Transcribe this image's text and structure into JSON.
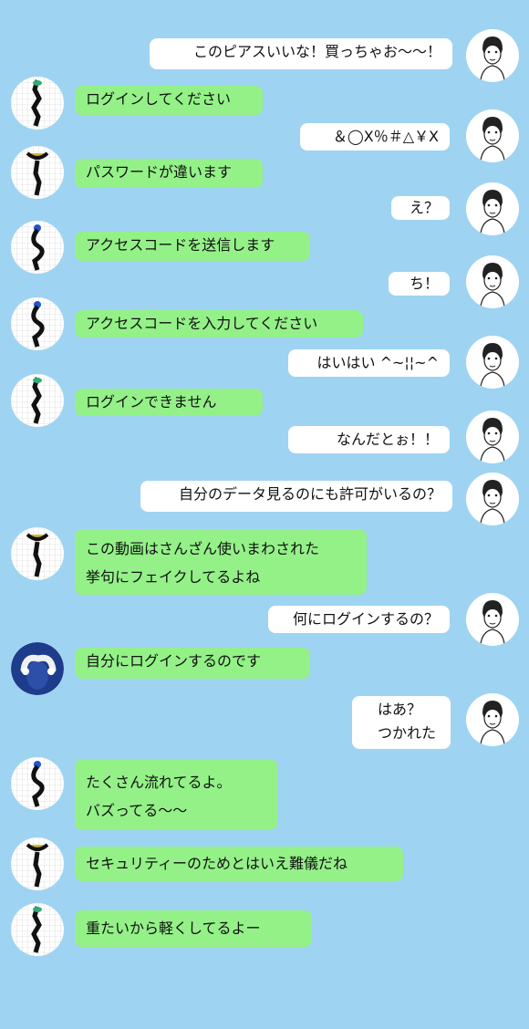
{
  "chat": {
    "messages": [
      {
        "from": "me",
        "lines": [
          "このピアスいいな！買っちゃお〜〜！"
        ]
      },
      {
        "from": "other",
        "lines": [
          "ログインしてください"
        ]
      },
      {
        "from": "me",
        "lines": [
          "＆◯X％＃△￥X"
        ]
      },
      {
        "from": "other",
        "lines": [
          "パスワードが違います"
        ]
      },
      {
        "from": "me",
        "lines": [
          "え？"
        ]
      },
      {
        "from": "other",
        "lines": [
          "アクセスコードを送信します"
        ]
      },
      {
        "from": "me",
        "lines": [
          "ち！"
        ]
      },
      {
        "from": "other",
        "lines": [
          "アクセスコードを入力してください"
        ]
      },
      {
        "from": "me",
        "lines": [
          "はいはい ^~¦¦~^"
        ]
      },
      {
        "from": "other",
        "lines": [
          "ログインできません"
        ]
      },
      {
        "from": "me",
        "lines": [
          "なんだとぉ！！"
        ]
      },
      {
        "from": "me",
        "lines": [
          "自分のデータ見るのにも許可がいるの？"
        ]
      },
      {
        "from": "other",
        "lines": [
          "この動画はさんざん使いまわされた",
          "挙句にフェイクしてるよね"
        ]
      },
      {
        "from": "me",
        "lines": [
          "何にログインするの？"
        ]
      },
      {
        "from": "other",
        "lines": [
          "自分にログインするのです"
        ]
      },
      {
        "from": "me",
        "lines": [
          "はあ？",
          "つかれた"
        ]
      },
      {
        "from": "other",
        "lines": [
          "たくさん流れてるよ。",
          "バズってる〜〜"
        ]
      },
      {
        "from": "other",
        "lines": [
          "セキュリティーのためとはいえ難儀だね"
        ]
      },
      {
        "from": "other",
        "lines": [
          "重たいから軽くしてるよー"
        ]
      }
    ]
  },
  "colors": {
    "background": "#9fd3f2",
    "me_bubble": "#ffffff",
    "other_bubble": "#94f188"
  },
  "icons": {
    "me_avatar": "woman-sketch-avatar",
    "other_avatar": "phone-cable-avatar",
    "alt_avatar": "blue-figure-avatar"
  }
}
